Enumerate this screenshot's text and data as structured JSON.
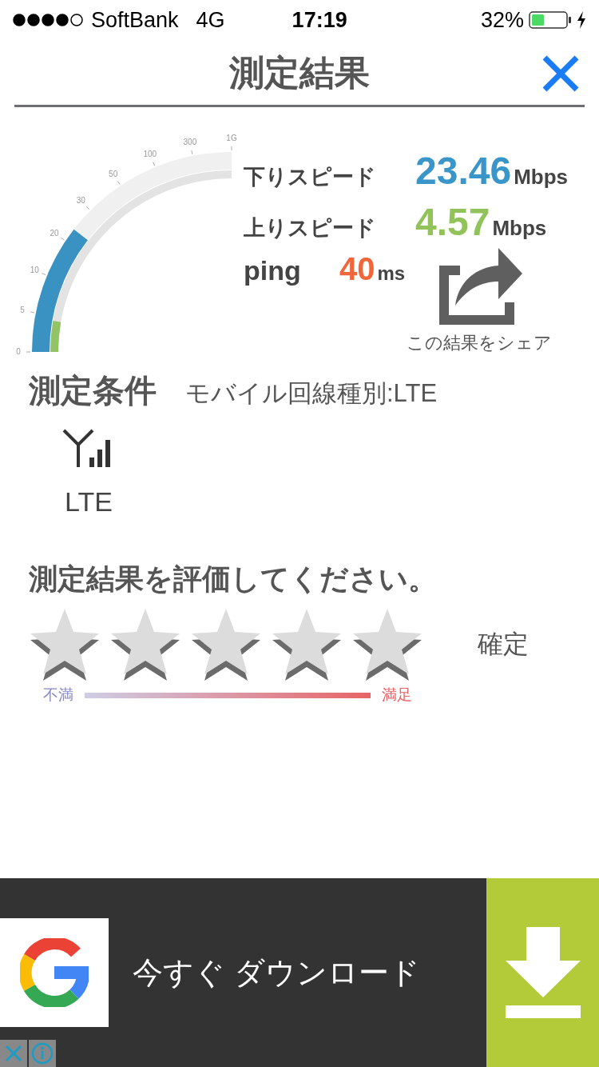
{
  "status_bar": {
    "carrier": "SoftBank",
    "network": "4G",
    "time": "17:19",
    "battery": "32%"
  },
  "header": {
    "title": "測定結果"
  },
  "gauge": {
    "ticks": [
      "0",
      "5",
      "10",
      "20",
      "30",
      "50",
      "100",
      "300",
      "1G"
    ],
    "bars": [
      {
        "kind": "download",
        "color": "#3a92c2"
      },
      {
        "kind": "upload",
        "color": "#92c465"
      }
    ]
  },
  "results": [
    {
      "kind": "speed",
      "label": "下りスピード",
      "value": "23.46",
      "unit": "Mbps",
      "color": "#3a95c9"
    },
    {
      "kind": "speed",
      "label": "上りスピード",
      "value": "4.57",
      "unit": "Mbps",
      "color": "#92c35a"
    },
    {
      "kind": "ping",
      "label": "ping",
      "value": "40",
      "unit": "ms",
      "color": "#f0663a"
    }
  ],
  "share": {
    "label": "この結果をシェア"
  },
  "conditions": {
    "title": "測定条件",
    "detail": "モバイル回線種別:LTE",
    "network": "LTE"
  },
  "rating": {
    "prompt": "測定結果を評価してください。",
    "stars": 0,
    "low_label": "不満",
    "high_label": "満足",
    "confirm": "確定"
  },
  "ad": {
    "text": "今すぐ ダウンロード"
  }
}
